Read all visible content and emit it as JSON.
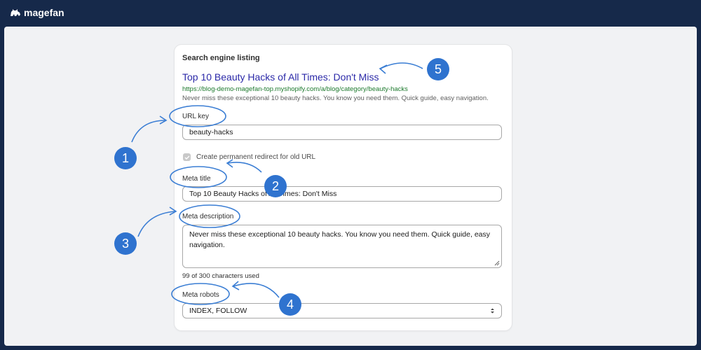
{
  "brand": {
    "name": "magefan"
  },
  "section": {
    "title": "Search engine listing"
  },
  "preview": {
    "title": "Top 10 Beauty Hacks of All Times: Don't Miss",
    "url": "https://blog-demo-magefan-top.myshopify.com/a/blog/category/beauty-hacks",
    "description": "Never miss these exceptional 10 beauty hacks. You know you need them. Quick guide, easy navigation."
  },
  "url_key": {
    "label": "URL key",
    "value": "beauty-hacks"
  },
  "redirect": {
    "label": "Create permanent redirect for old URL",
    "checked": true
  },
  "meta_title": {
    "label": "Meta title",
    "value": "Top 10 Beauty Hacks of All Times: Don't Miss"
  },
  "meta_description": {
    "label": "Meta description",
    "value": "Never miss these exceptional 10 beauty hacks. You know you need them. Quick guide, easy navigation.",
    "counter": "99 of 300 characters used"
  },
  "meta_robots": {
    "label": "Meta robots",
    "value": "INDEX, FOLLOW",
    "options": [
      "INDEX, FOLLOW"
    ]
  },
  "annotations": [
    "1",
    "2",
    "3",
    "4",
    "5"
  ],
  "colors": {
    "accent": "#2f73cf",
    "frame": "#16294a",
    "link": "#2b29a8",
    "url": "#1e7a2e"
  }
}
